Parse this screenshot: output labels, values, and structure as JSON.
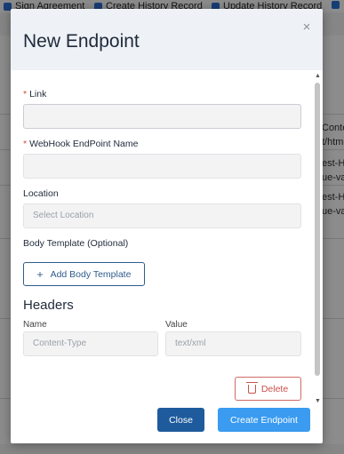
{
  "background": {
    "checkboxes": [
      "Sign Agreement",
      "Create History Record",
      "Update History Record"
    ],
    "side_text": [
      "Conten",
      "t/htm",
      "est-H",
      "ue-va",
      "est-H",
      "ue-va"
    ]
  },
  "modal": {
    "title": "New Endpoint",
    "close_glyph": "×"
  },
  "form": {
    "link": {
      "label": "Link",
      "required_mark": "*",
      "value": ""
    },
    "webhook_name": {
      "label": "WebHook EndPoint Name",
      "required_mark": "*",
      "value": ""
    },
    "location": {
      "label": "Location",
      "placeholder": "Select Location"
    },
    "body_template": {
      "label": "Body Template (Optional)",
      "button_label": "Add Body Template",
      "button_icon": "plus-icon",
      "plus_glyph": "+"
    }
  },
  "headers": {
    "title": "Headers",
    "name_label": "Name",
    "value_label": "Value",
    "name_placeholder": "Content-Type",
    "value_placeholder": "text/xml",
    "delete_label": "Delete",
    "delete_icon": "trash-icon"
  },
  "footer": {
    "close_label": "Close",
    "create_label": "Create Endpoint"
  },
  "colors": {
    "primary": "#1e5b9c",
    "accent": "#3a9bf0",
    "danger": "#c9514b",
    "required": "#d9473d"
  }
}
